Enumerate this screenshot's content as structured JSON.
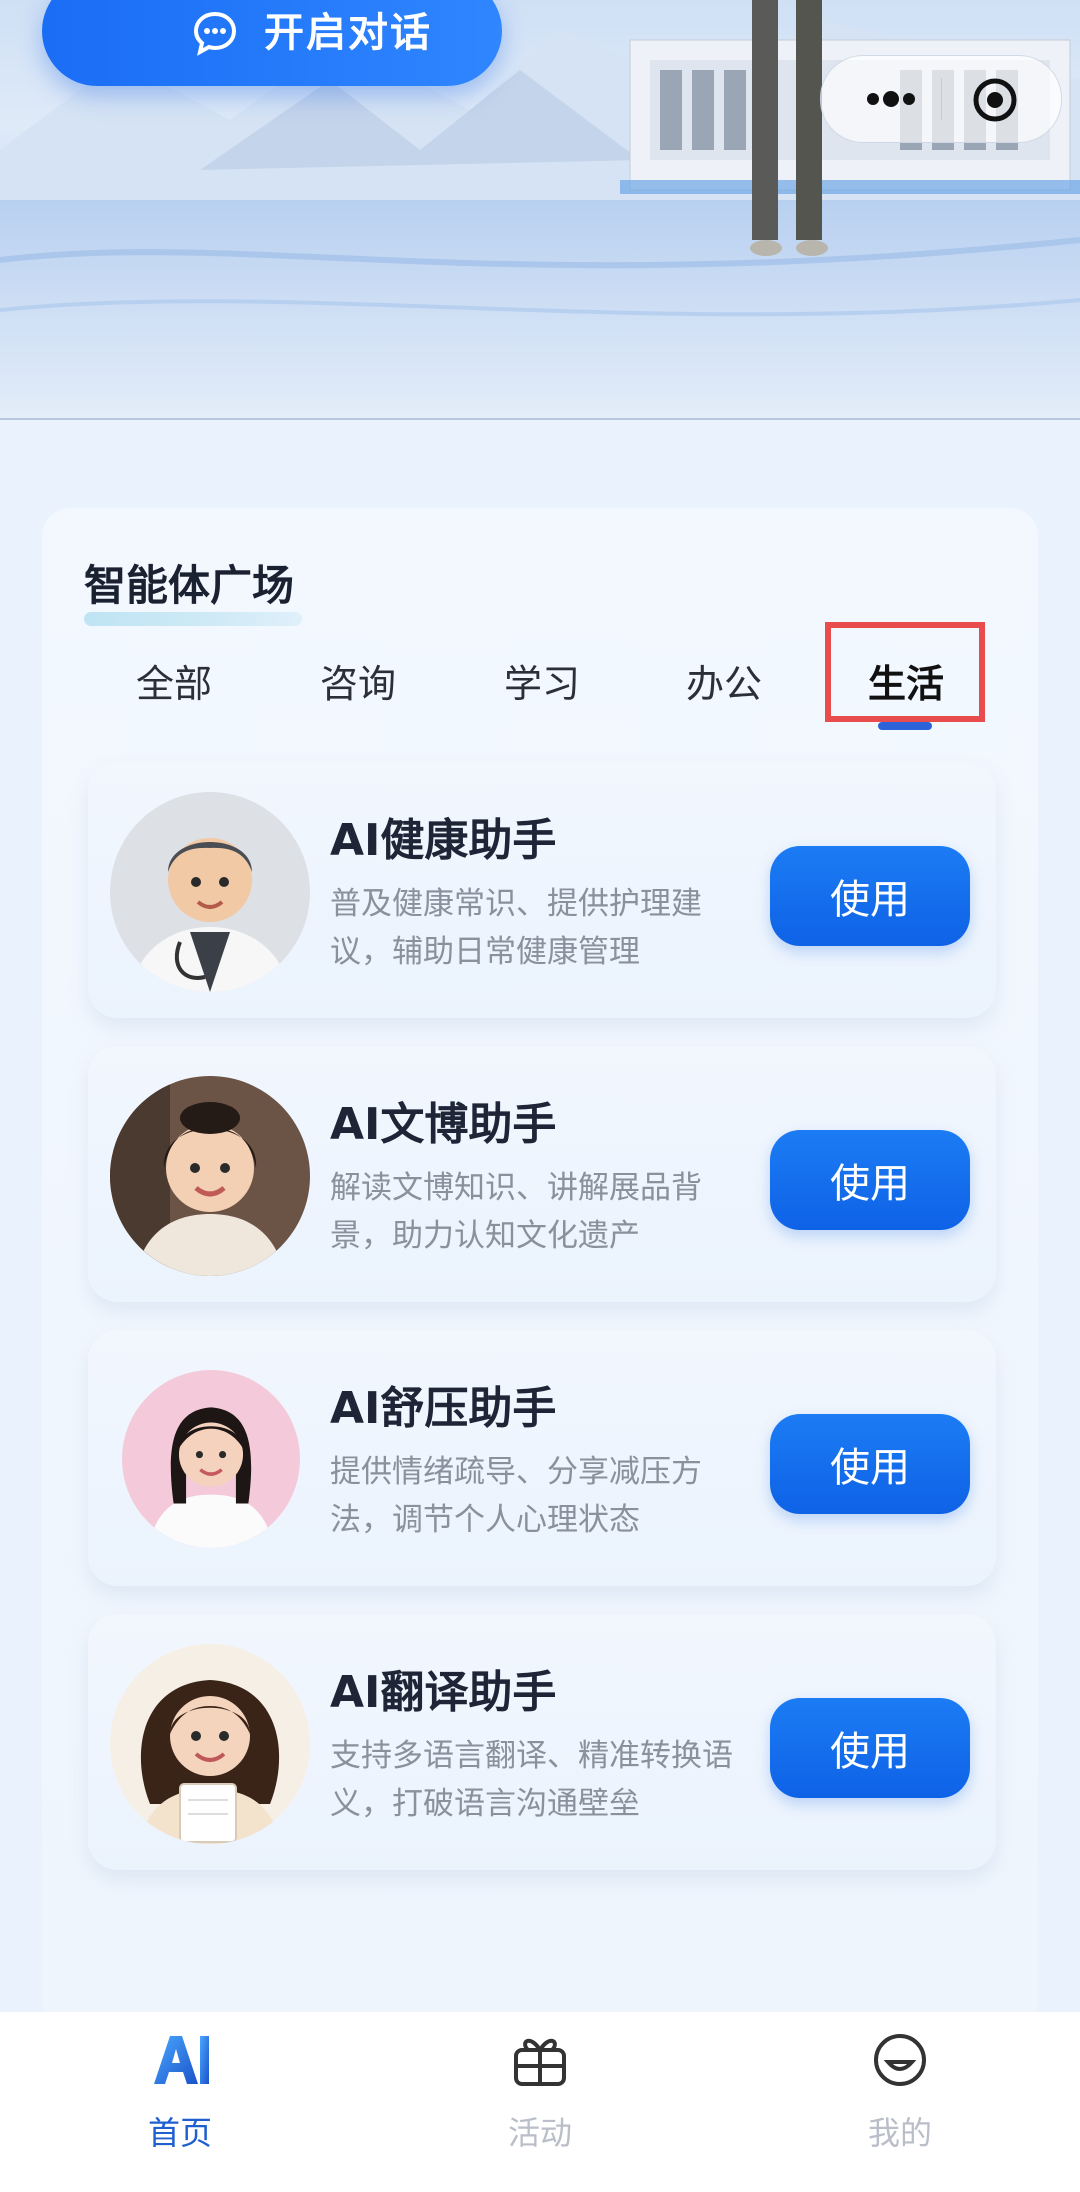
{
  "hero": {
    "start_chat_label": "开启对话"
  },
  "plaza": {
    "title": "智能体广场",
    "tabs": [
      "全部",
      "咨询",
      "学习",
      "办公",
      "生活"
    ],
    "active_tab": "生活",
    "agents": [
      {
        "name": "AI健康助手",
        "desc": "普及健康常识、提供护理建议，辅助日常健康管理",
        "button": "使用"
      },
      {
        "name": "AI文博助手",
        "desc": "解读文博知识、讲解展品背景，助力认知文化遗产",
        "button": "使用"
      },
      {
        "name": "AI舒压助手",
        "desc": "提供情绪疏导、分享减压方法，调节个人心理状态",
        "button": "使用"
      },
      {
        "name": "AI翻译助手",
        "desc": "支持多语言翻译、精准转换语义，打破语言沟通壁垒",
        "button": "使用"
      }
    ]
  },
  "bottom_nav": {
    "items": [
      {
        "label": "首页",
        "icon": "ai-logo-icon",
        "active": true
      },
      {
        "label": "活动",
        "icon": "gift-icon",
        "active": false
      },
      {
        "label": "我的",
        "icon": "smile-face-icon",
        "active": false
      }
    ]
  },
  "colors": {
    "accent": "#1a6df5",
    "highlight": "#e84c4c",
    "active_nav": "#1f5fcf"
  }
}
